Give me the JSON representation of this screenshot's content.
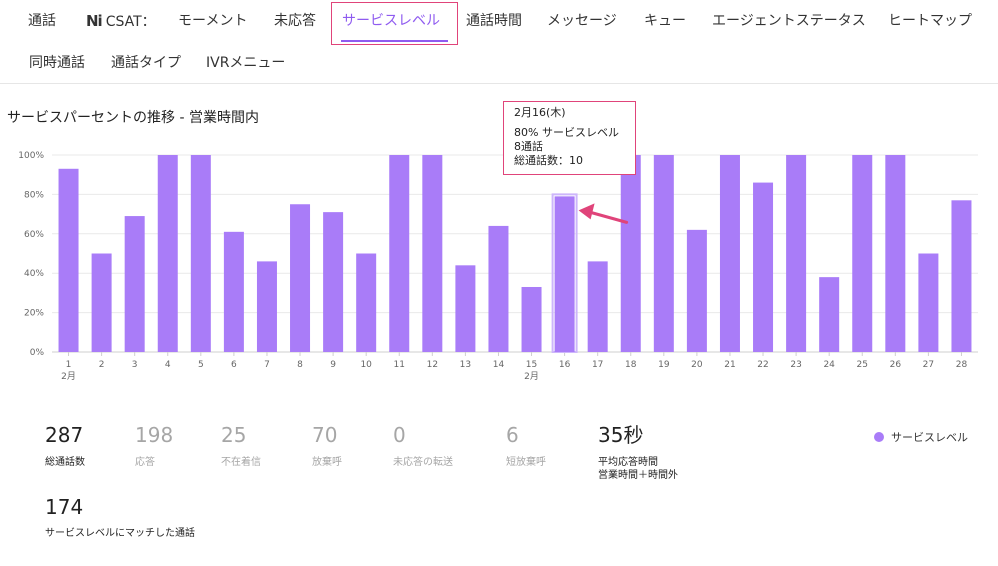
{
  "tabs_row1": [
    "通話",
    "CSAT：",
    "モーメント",
    "未応答",
    "サービスレベル",
    "通話時間",
    "メッセージ",
    "キュー",
    "エージェントステータス",
    "ヒートマップ"
  ],
  "tabs_row2": [
    "同時通話",
    "通話タイプ",
    "IVRメニュー"
  ],
  "ni_logo": "Ni",
  "colors": {
    "accent": "#8f5bf0",
    "bar": "#a97cf8",
    "highlight": "#e0447a"
  },
  "chart_title": "サービスパーセントの推移 - 営業時間内",
  "chart_data": {
    "type": "bar",
    "categories": [
      "1",
      "2",
      "3",
      "4",
      "5",
      "6",
      "7",
      "8",
      "9",
      "10",
      "11",
      "12",
      "13",
      "14",
      "15",
      "16",
      "17",
      "18",
      "19",
      "20",
      "21",
      "22",
      "23",
      "24",
      "25",
      "26",
      "27",
      "28"
    ],
    "category_sub": {
      "0": "2月",
      "14": "2月"
    },
    "values": [
      93,
      50,
      69,
      100,
      100,
      61,
      46,
      75,
      71,
      50,
      100,
      100,
      44,
      64,
      33,
      79,
      46,
      100,
      100,
      62,
      100,
      86,
      100,
      38,
      100,
      100,
      50,
      77
    ],
    "ylim": [
      0,
      100
    ],
    "yticks": [
      "0%",
      "20%",
      "40%",
      "60%",
      "80%",
      "100%"
    ],
    "grid": true,
    "highlighted_category": "16"
  },
  "tooltip": {
    "date": "2月16(木)",
    "line1": "80% サービスレベル",
    "line2": "8通話",
    "line3": "総通話数：10"
  },
  "stats": [
    {
      "value": "287",
      "label": "総通話数"
    },
    {
      "value": "198",
      "label": "応答"
    },
    {
      "value": "25",
      "label": "不在着信"
    },
    {
      "value": "70",
      "label": "放棄呼"
    },
    {
      "value": "0",
      "label": "未応答の転送"
    },
    {
      "value": "6",
      "label": "短放棄呼"
    },
    {
      "value": "35秒",
      "label": "平均応答時間",
      "label2": "営業時間＋時間外"
    },
    {
      "value": "174",
      "label": "サービスレベルにマッチした通話"
    }
  ],
  "legend": "サービスレベル"
}
